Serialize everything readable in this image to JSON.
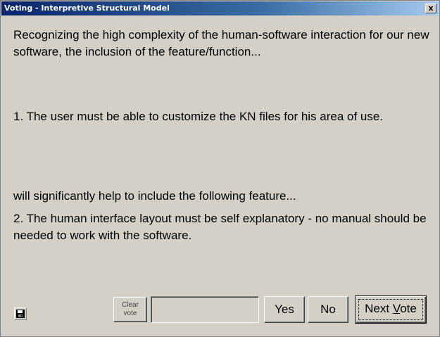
{
  "window": {
    "title": "Voting - Interpretive Structural Model",
    "close_glyph": "x"
  },
  "content": {
    "intro": "Recognizing the high complexity of the human-software interaction for our new software, the inclusion of the feature/function...",
    "item1": " 1. The user must be able to customize the KN files for his area of use.",
    "connector": "will significantly help to include the following feature...",
    "item2": " 2. The human interface layout must be self explanatory - no manual should be needed to work with the software."
  },
  "footer": {
    "save_icon": "floppy-disk-icon",
    "clear_vote_label_line1": "Clear",
    "clear_vote_label_line2": "vote",
    "vote_value": "",
    "yes_label": "Yes",
    "no_label": "No",
    "next_vote_label_prefix": "Next ",
    "next_vote_label_access": "V",
    "next_vote_label_suffix": "ote"
  }
}
